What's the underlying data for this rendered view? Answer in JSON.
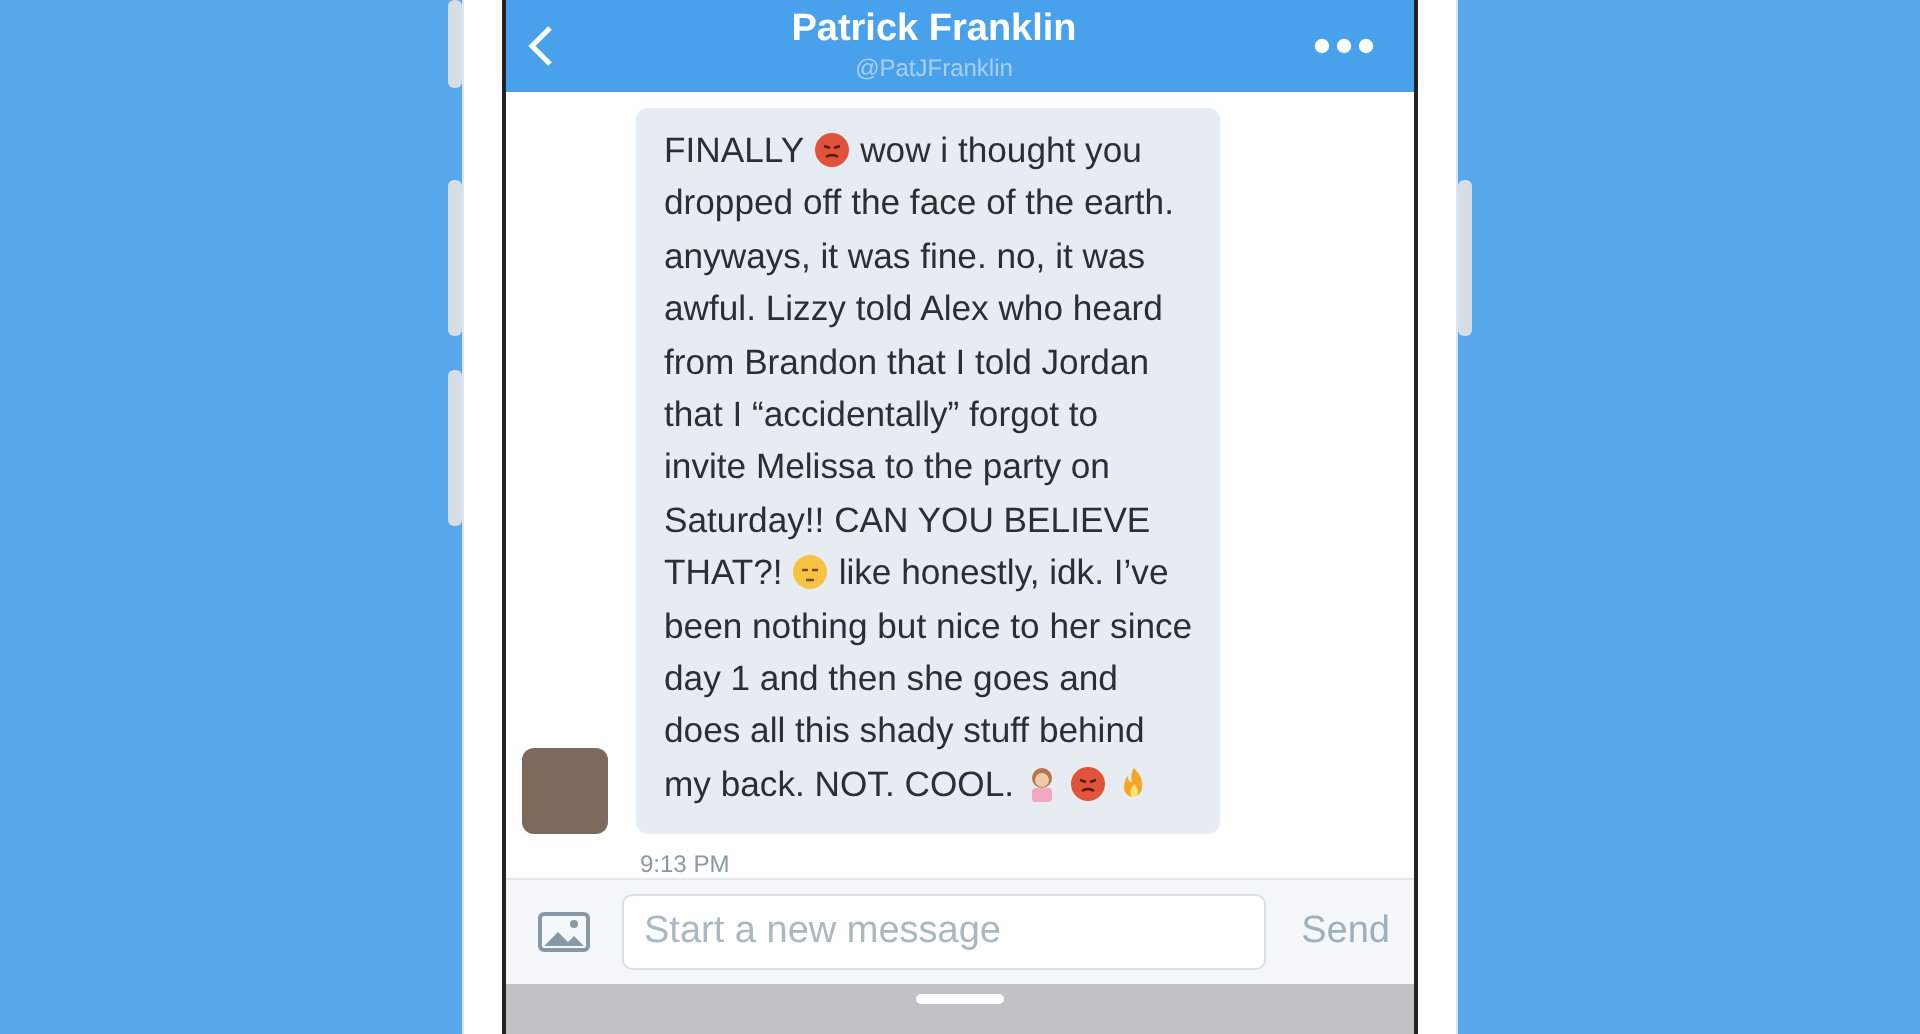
{
  "header": {
    "title": "Patrick Franklin",
    "handle": "@PatJFranklin"
  },
  "message": {
    "lines": [
      [
        {
          "kind": "text",
          "text": "FINALLY"
        },
        {
          "kind": "angry"
        },
        {
          "kind": "text",
          "text": "wow i thought you"
        }
      ],
      [
        {
          "kind": "text",
          "text": "dropped off the face of the earth."
        }
      ],
      [
        {
          "kind": "text",
          "text": "anyways, it was fine. no, it was"
        }
      ],
      [
        {
          "kind": "text",
          "text": "awful. Lizzy told Alex who heard"
        }
      ],
      [
        {
          "kind": "text",
          "text": "from Brandon that I told Jordan"
        }
      ],
      [
        {
          "kind": "text",
          "text": "that I “accidentally” forgot to"
        }
      ],
      [
        {
          "kind": "text",
          "text": "invite Melissa to the party on"
        }
      ],
      [
        {
          "kind": "text",
          "text": "Saturday!! CAN YOU BELIEVE"
        }
      ],
      [
        {
          "kind": "text",
          "text": "THAT?!"
        },
        {
          "kind": "unamused"
        },
        {
          "kind": "text",
          "text": "like honestly, idk. I’ve"
        }
      ],
      [
        {
          "kind": "text",
          "text": "been nothing but nice to her since"
        }
      ],
      [
        {
          "kind": "text",
          "text": "day 1 and then she goes and"
        }
      ],
      [
        {
          "kind": "text",
          "text": "does all this shady stuff behind"
        }
      ],
      [
        {
          "kind": "text",
          "text": "my back. NOT. COOL."
        },
        {
          "kind": "gesture"
        },
        {
          "kind": "angry"
        },
        {
          "kind": "fire"
        }
      ]
    ],
    "time": "9:13 PM"
  },
  "composer": {
    "placeholder": "Start a new message",
    "send": "Send"
  }
}
